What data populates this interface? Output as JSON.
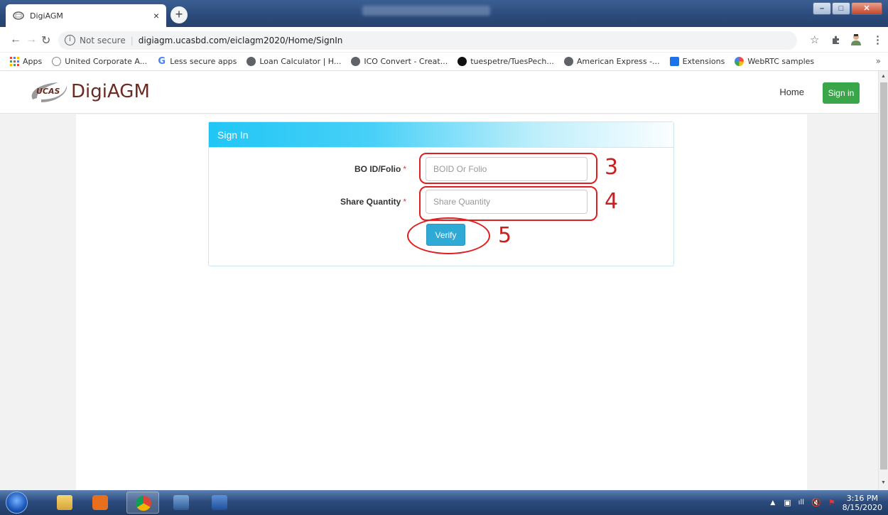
{
  "browser": {
    "tab_title": "DigiAGM",
    "tab_close": "×",
    "newtab": "+",
    "not_secure": "Not secure",
    "url": "digiagm.ucasbd.com/eiclagm2020/Home/SignIn",
    "bookmarks": [
      {
        "label": "Apps",
        "icon": "apps-grid-icon"
      },
      {
        "label": "United Corporate A...",
        "icon": "ucas-favicon"
      },
      {
        "label": "Less secure apps",
        "icon": "google-icon"
      },
      {
        "label": "Loan Calculator | H...",
        "icon": "globe-icon"
      },
      {
        "label": "ICO Convert - Creat...",
        "icon": "globe-icon"
      },
      {
        "label": "tuespetre/TuesPech...",
        "icon": "github-icon"
      },
      {
        "label": "American Express -...",
        "icon": "globe-icon"
      },
      {
        "label": "Extensions",
        "icon": "puzzle-icon"
      },
      {
        "label": "WebRTC samples",
        "icon": "webrtc-icon"
      }
    ],
    "bookmarks_more": "»"
  },
  "site": {
    "logo_badge": "UCAS",
    "logo_name": "DigiAGM",
    "nav_home": "Home",
    "nav_signin": "Sign in"
  },
  "form": {
    "panel_title": "Sign In",
    "boid_label": "BO ID/Folio",
    "boid_placeholder": "BOID Or Folio",
    "share_label": "Share Quantity",
    "share_placeholder": "Share Quantity",
    "required_mark": "*",
    "verify_label": "Verify"
  },
  "annotations": {
    "n3": "3",
    "n4": "4",
    "n5": "5",
    "color": "#e02020"
  },
  "taskbar": {
    "time": "3:16 PM",
    "date": "8/15/2020"
  }
}
